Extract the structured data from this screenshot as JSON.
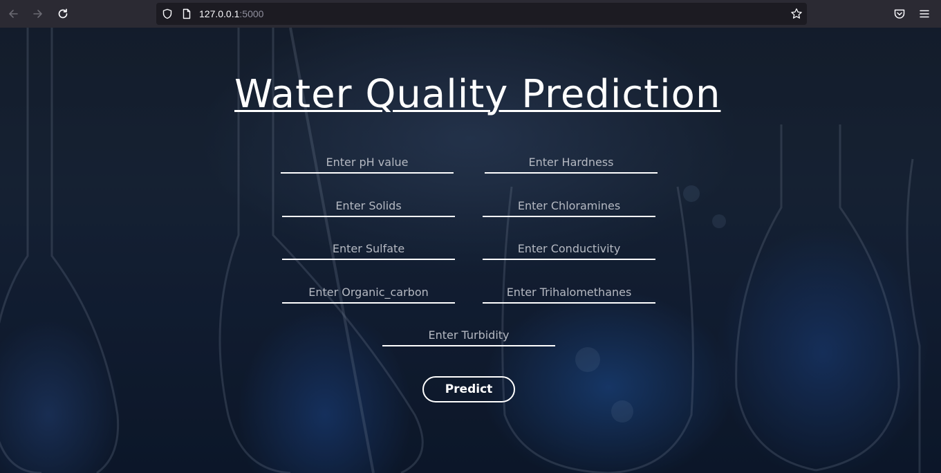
{
  "browser": {
    "url_host": "127.0.0.1",
    "url_port": ":5000",
    "icons": {
      "back": "arrow-left-icon",
      "forward": "arrow-right-icon",
      "reload": "reload-icon",
      "tracking": "shield-icon",
      "page": "page-icon",
      "bookmark": "star-icon",
      "pocket": "pocket-icon",
      "menu": "hamburger-menu-icon"
    }
  },
  "page": {
    "title": "Water Quality Prediction",
    "fields": [
      {
        "placeholder": "Enter pH value"
      },
      {
        "placeholder": "Enter Hardness"
      },
      {
        "placeholder": "Enter Solids"
      },
      {
        "placeholder": "Enter Chloramines"
      },
      {
        "placeholder": "Enter Sulfate"
      },
      {
        "placeholder": "Enter Conductivity"
      },
      {
        "placeholder": "Enter Organic_carbon"
      },
      {
        "placeholder": "Enter Trihalomethanes"
      },
      {
        "placeholder": "Enter Turbidity"
      }
    ],
    "submit_label": "Predict"
  },
  "colors": {
    "chrome": "#2b2a33",
    "urlbar": "#1c1b22",
    "text": "#ffffff",
    "placeholder": "#b5b9c2"
  }
}
